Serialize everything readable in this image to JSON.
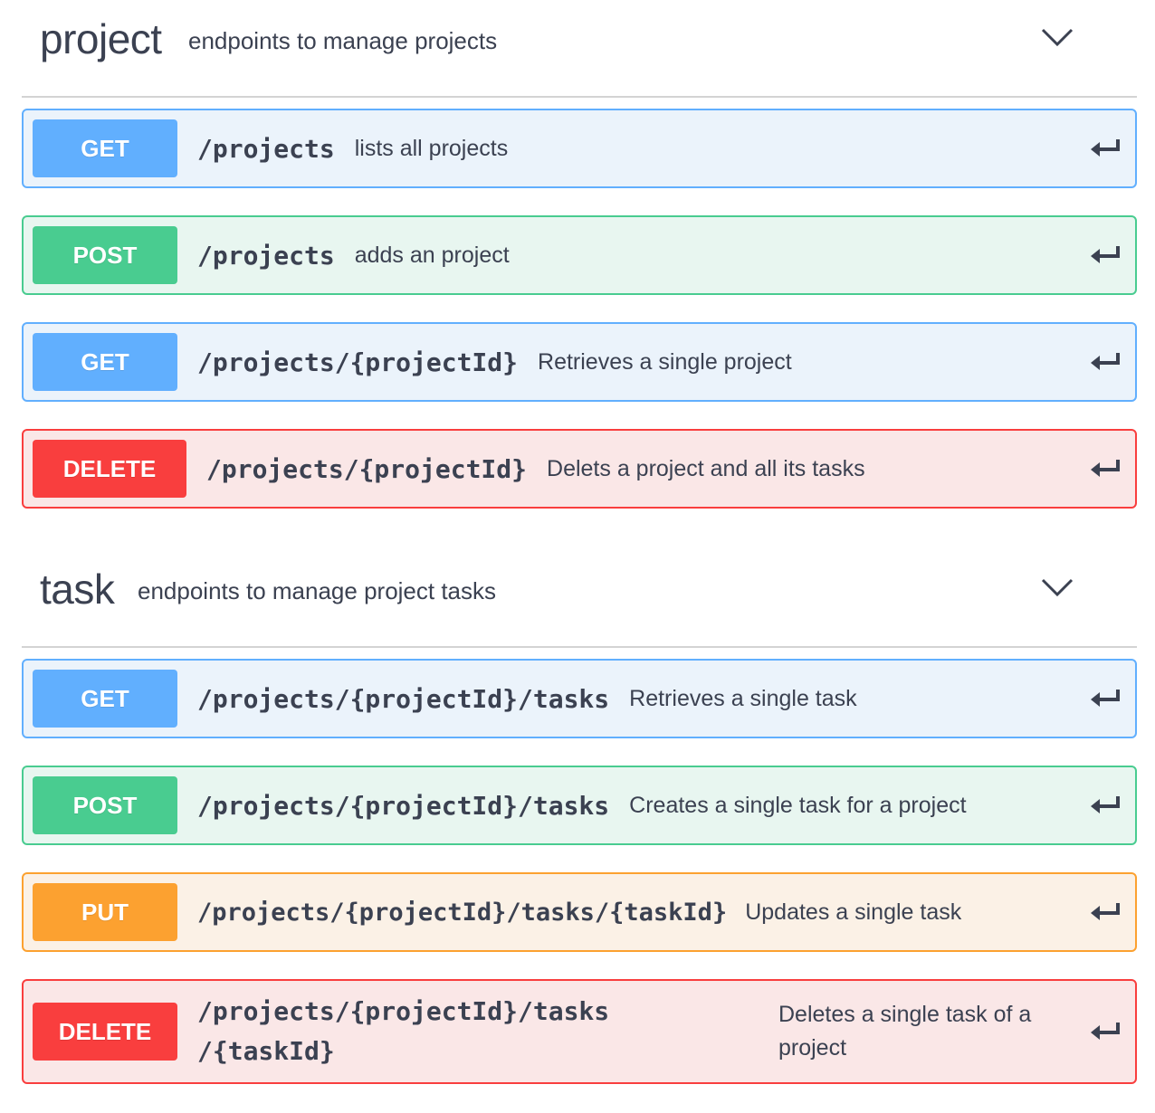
{
  "sections": [
    {
      "name": "project",
      "description": "endpoints to manage projects",
      "operations": [
        {
          "method": "GET",
          "path": "/projects",
          "summary": "lists all projects"
        },
        {
          "method": "POST",
          "path": "/projects",
          "summary": "adds an project"
        },
        {
          "method": "GET",
          "path": "/projects/{projectId}",
          "summary": "Retrieves a single project"
        },
        {
          "method": "DELETE",
          "path": "/projects/{projectId}",
          "summary": "Delets a project and all its tasks"
        }
      ]
    },
    {
      "name": "task",
      "description": "endpoints to manage project tasks",
      "operations": [
        {
          "method": "GET",
          "path": "/projects/{projectId}/tasks",
          "summary": "Retrieves a single task"
        },
        {
          "method": "POST",
          "path": "/projects/{projectId}/tasks",
          "summary": "Creates a single task for a project"
        },
        {
          "method": "PUT",
          "path": "/projects/{projectId}/tasks/{taskId}",
          "summary": "Updates a single task"
        },
        {
          "method": "DELETE",
          "path": "/projects/{projectId}/tasks/{taskId}",
          "path_line1": "/projects/{projectId}/tasks",
          "path_line2": "/{taskId}",
          "summary": "Deletes a single task of a project"
        }
      ]
    }
  ],
  "icons": {
    "collapse": "chevron-down-icon",
    "try": "enter-arrow-icon"
  },
  "colors": {
    "get": "#61affe",
    "post": "#49cc90",
    "put": "#fca130",
    "delete": "#f93e3e"
  }
}
